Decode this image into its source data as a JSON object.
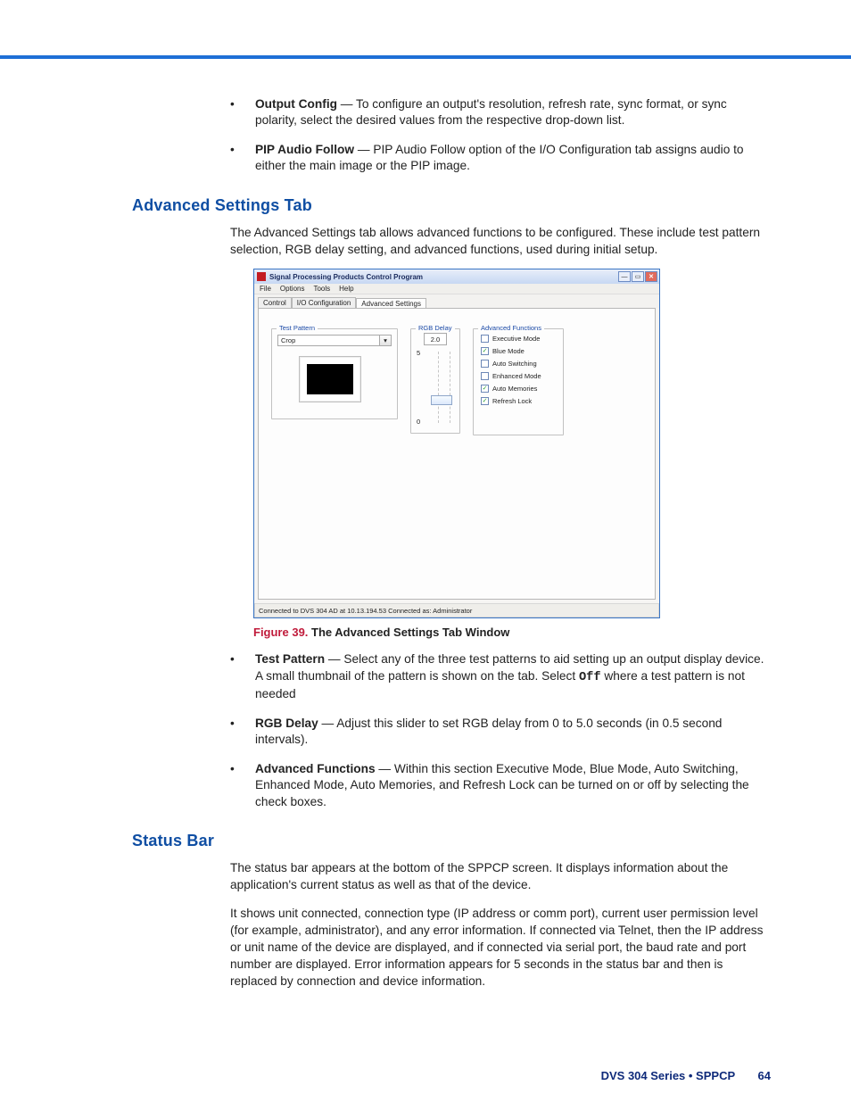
{
  "intro_bullets": [
    {
      "term": "Output Config",
      "text": " — To configure an output's resolution, refresh rate, sync format, or sync polarity, select the desired values from the respective drop-down list."
    },
    {
      "term": "PIP Audio Follow",
      "text": " — PIP Audio Follow option of the I/O Configuration tab assigns audio to either the main image or the PIP image."
    }
  ],
  "advanced": {
    "heading": "Advanced Settings Tab",
    "intro": "The Advanced Settings tab allows advanced functions to be configured. These include test pattern selection, RGB delay setting, and advanced functions, used during initial setup.",
    "figure": {
      "num": "Figure 39.",
      "title": "The Advanced Settings Tab Window"
    },
    "bullets": [
      {
        "term": "Test Pattern",
        "before": " — Select any of the three test patterns to aid setting up an output display device. A small thumbnail of the pattern is shown on the tab. Select ",
        "mono": "Off",
        "after": " where a test pattern is not needed"
      },
      {
        "term": "RGB Delay",
        "text": " — Adjust this slider to set RGB delay from 0 to 5.0 seconds (in 0.5 second intervals)."
      },
      {
        "term": "Advanced Functions",
        "text": " — Within this section Executive Mode, Blue Mode, Auto Switching, Enhanced Mode, Auto Memories, and Refresh Lock can be turned on or off by selecting the check boxes."
      }
    ]
  },
  "statusbar": {
    "heading": "Status Bar",
    "p1": "The status bar appears at the bottom of the SPPCP screen. It displays information about the application's current status as well as that of the device.",
    "p2": "It shows unit connected, connection type (IP address or comm port), current user permission level (for example, administrator), and any error information. If connected via Telnet, then the IP address or unit name of the device are displayed, and if connected via serial port, the baud rate and port number are displayed. Error information appears for 5 seconds in the status bar and then is replaced by connection and device information."
  },
  "app": {
    "title": "Signal Processing Products Control Program",
    "menu": [
      "File",
      "Options",
      "Tools",
      "Help"
    ],
    "tabs": [
      "Control",
      "I/O Configuration",
      "Advanced Settings"
    ],
    "active_tab": 2,
    "test_pattern": {
      "legend": "Test Pattern",
      "value": "Crop"
    },
    "rgb": {
      "legend": "RGB Delay",
      "value": "2.0",
      "max": "5",
      "min": "0"
    },
    "af": {
      "legend": "Advanced Functions",
      "items": [
        {
          "label": "Executive Mode",
          "checked": false
        },
        {
          "label": "Blue Mode",
          "checked": true
        },
        {
          "label": "Auto Switching",
          "checked": false
        },
        {
          "label": "Enhanced Mode",
          "checked": false
        },
        {
          "label": "Auto Memories",
          "checked": true
        },
        {
          "label": "Refresh Lock",
          "checked": true
        }
      ]
    },
    "status": "Connected to DVS 304 AD at 10.13.194.53   Connected as: Administrator"
  },
  "footer": {
    "left": "DVS 304 Series • SPPCP",
    "page": "64"
  }
}
